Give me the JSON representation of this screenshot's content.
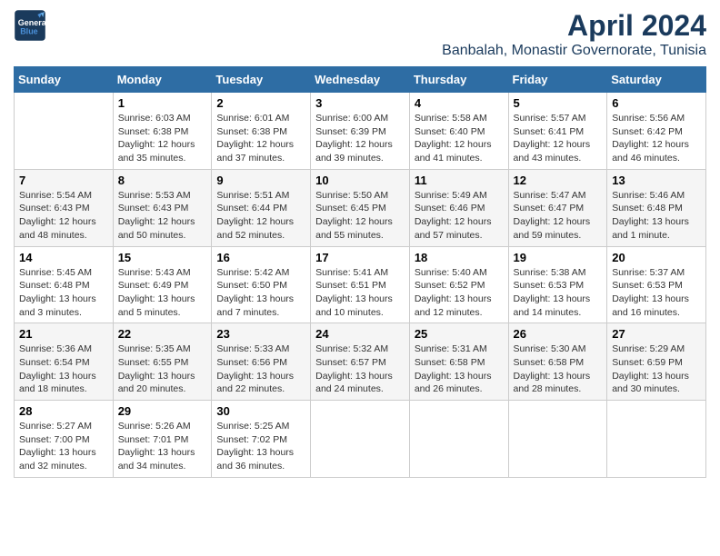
{
  "header": {
    "logo_line1": "General",
    "logo_line2": "Blue",
    "title": "April 2024",
    "subtitle": "Banbalah, Monastir Governorate, Tunisia"
  },
  "weekdays": [
    "Sunday",
    "Monday",
    "Tuesday",
    "Wednesday",
    "Thursday",
    "Friday",
    "Saturday"
  ],
  "weeks": [
    [
      {
        "day": "",
        "info": ""
      },
      {
        "day": "1",
        "info": "Sunrise: 6:03 AM\nSunset: 6:38 PM\nDaylight: 12 hours\nand 35 minutes."
      },
      {
        "day": "2",
        "info": "Sunrise: 6:01 AM\nSunset: 6:38 PM\nDaylight: 12 hours\nand 37 minutes."
      },
      {
        "day": "3",
        "info": "Sunrise: 6:00 AM\nSunset: 6:39 PM\nDaylight: 12 hours\nand 39 minutes."
      },
      {
        "day": "4",
        "info": "Sunrise: 5:58 AM\nSunset: 6:40 PM\nDaylight: 12 hours\nand 41 minutes."
      },
      {
        "day": "5",
        "info": "Sunrise: 5:57 AM\nSunset: 6:41 PM\nDaylight: 12 hours\nand 43 minutes."
      },
      {
        "day": "6",
        "info": "Sunrise: 5:56 AM\nSunset: 6:42 PM\nDaylight: 12 hours\nand 46 minutes."
      }
    ],
    [
      {
        "day": "7",
        "info": "Sunrise: 5:54 AM\nSunset: 6:43 PM\nDaylight: 12 hours\nand 48 minutes."
      },
      {
        "day": "8",
        "info": "Sunrise: 5:53 AM\nSunset: 6:43 PM\nDaylight: 12 hours\nand 50 minutes."
      },
      {
        "day": "9",
        "info": "Sunrise: 5:51 AM\nSunset: 6:44 PM\nDaylight: 12 hours\nand 52 minutes."
      },
      {
        "day": "10",
        "info": "Sunrise: 5:50 AM\nSunset: 6:45 PM\nDaylight: 12 hours\nand 55 minutes."
      },
      {
        "day": "11",
        "info": "Sunrise: 5:49 AM\nSunset: 6:46 PM\nDaylight: 12 hours\nand 57 minutes."
      },
      {
        "day": "12",
        "info": "Sunrise: 5:47 AM\nSunset: 6:47 PM\nDaylight: 12 hours\nand 59 minutes."
      },
      {
        "day": "13",
        "info": "Sunrise: 5:46 AM\nSunset: 6:48 PM\nDaylight: 13 hours\nand 1 minute."
      }
    ],
    [
      {
        "day": "14",
        "info": "Sunrise: 5:45 AM\nSunset: 6:48 PM\nDaylight: 13 hours\nand 3 minutes."
      },
      {
        "day": "15",
        "info": "Sunrise: 5:43 AM\nSunset: 6:49 PM\nDaylight: 13 hours\nand 5 minutes."
      },
      {
        "day": "16",
        "info": "Sunrise: 5:42 AM\nSunset: 6:50 PM\nDaylight: 13 hours\nand 7 minutes."
      },
      {
        "day": "17",
        "info": "Sunrise: 5:41 AM\nSunset: 6:51 PM\nDaylight: 13 hours\nand 10 minutes."
      },
      {
        "day": "18",
        "info": "Sunrise: 5:40 AM\nSunset: 6:52 PM\nDaylight: 13 hours\nand 12 minutes."
      },
      {
        "day": "19",
        "info": "Sunrise: 5:38 AM\nSunset: 6:53 PM\nDaylight: 13 hours\nand 14 minutes."
      },
      {
        "day": "20",
        "info": "Sunrise: 5:37 AM\nSunset: 6:53 PM\nDaylight: 13 hours\nand 16 minutes."
      }
    ],
    [
      {
        "day": "21",
        "info": "Sunrise: 5:36 AM\nSunset: 6:54 PM\nDaylight: 13 hours\nand 18 minutes."
      },
      {
        "day": "22",
        "info": "Sunrise: 5:35 AM\nSunset: 6:55 PM\nDaylight: 13 hours\nand 20 minutes."
      },
      {
        "day": "23",
        "info": "Sunrise: 5:33 AM\nSunset: 6:56 PM\nDaylight: 13 hours\nand 22 minutes."
      },
      {
        "day": "24",
        "info": "Sunrise: 5:32 AM\nSunset: 6:57 PM\nDaylight: 13 hours\nand 24 minutes."
      },
      {
        "day": "25",
        "info": "Sunrise: 5:31 AM\nSunset: 6:58 PM\nDaylight: 13 hours\nand 26 minutes."
      },
      {
        "day": "26",
        "info": "Sunrise: 5:30 AM\nSunset: 6:58 PM\nDaylight: 13 hours\nand 28 minutes."
      },
      {
        "day": "27",
        "info": "Sunrise: 5:29 AM\nSunset: 6:59 PM\nDaylight: 13 hours\nand 30 minutes."
      }
    ],
    [
      {
        "day": "28",
        "info": "Sunrise: 5:27 AM\nSunset: 7:00 PM\nDaylight: 13 hours\nand 32 minutes."
      },
      {
        "day": "29",
        "info": "Sunrise: 5:26 AM\nSunset: 7:01 PM\nDaylight: 13 hours\nand 34 minutes."
      },
      {
        "day": "30",
        "info": "Sunrise: 5:25 AM\nSunset: 7:02 PM\nDaylight: 13 hours\nand 36 minutes."
      },
      {
        "day": "",
        "info": ""
      },
      {
        "day": "",
        "info": ""
      },
      {
        "day": "",
        "info": ""
      },
      {
        "day": "",
        "info": ""
      }
    ]
  ]
}
